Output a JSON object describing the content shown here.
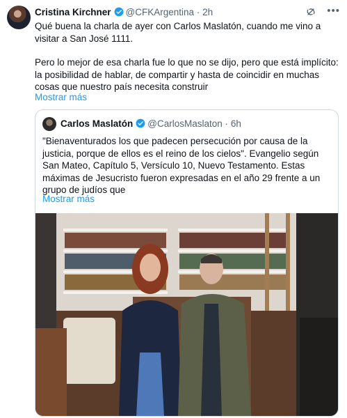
{
  "tweet": {
    "author_name": "Cristina Kirchner",
    "author_handle": "@CFKArgentina",
    "separator": "·",
    "time": "2h",
    "text_p1": "Qué buena la charla de ayer con Carlos Maslatón, cuando me vino a visitar a San José 1111.",
    "text_p2": "Pero lo mejor de esa charla fue lo que no se dijo, pero que está implícito: la posibilidad de hablar, de compartir y hasta de coincidir en muchas cosas que nuestro país necesita construir",
    "show_more": "Mostrar más"
  },
  "quote": {
    "author_name": "Carlos Maslatón",
    "author_handle": "@CarlosMaslaton",
    "separator": "·",
    "time": "6h",
    "text": "\"Bienaventurados los que padecen persecución por causa de la justicia, porque de ellos es el reino de los cielos\". Evangelio según San Mateo, Capítulo 5, Versículo 10, Nuevo Testamento. Estas máximas de Jesucristo fueron expresadas en el año 29 frente a un grupo de judíos que",
    "show_more": "Mostrar más"
  },
  "icons": {
    "verified": "verified-badge-icon",
    "grok": "grok-icon",
    "more": "more-options-icon"
  },
  "colors": {
    "accent": "#1d9bf0",
    "muted": "#536471",
    "text": "#0f1419",
    "border": "#cfd9de"
  }
}
